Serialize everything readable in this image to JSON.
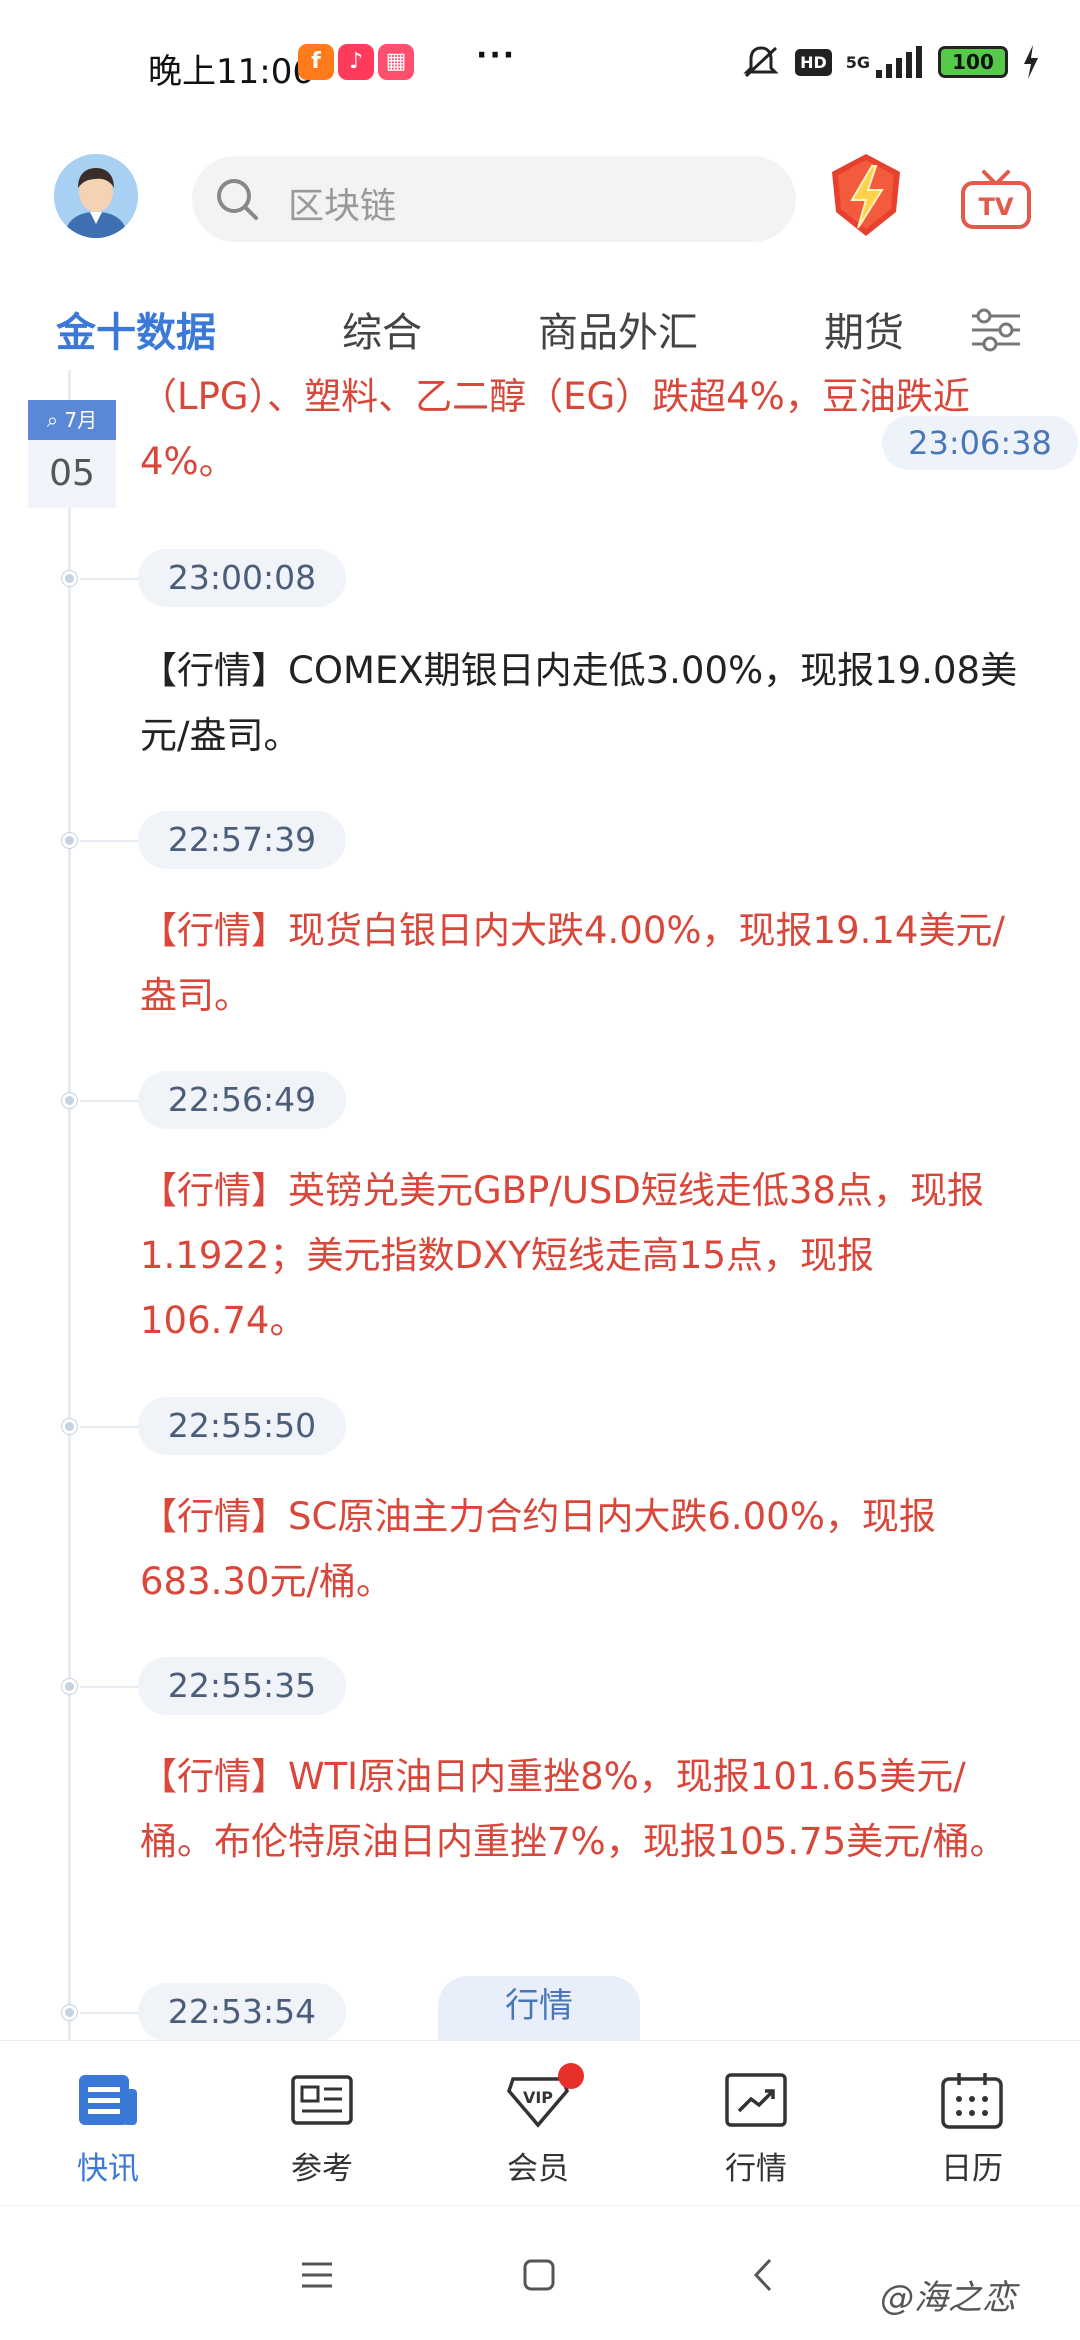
{
  "status_bar": {
    "time": "晚上11:06",
    "more": "···",
    "hd": "HD",
    "network": "5G",
    "battery": "100"
  },
  "header": {
    "search_placeholder": "区块链"
  },
  "tabs": [
    {
      "label": "金十数据",
      "active": true
    },
    {
      "label": "综合",
      "active": false
    },
    {
      "label": "商品外汇",
      "active": false
    },
    {
      "label": "期货",
      "active": false
    }
  ],
  "feed": {
    "date_month": "7月",
    "date_day": "05",
    "current_time": "23:06:38",
    "top_item_text": "（LPG）、塑料、乙二醇（EG）跌超4%，豆油跌近4%。",
    "items": [
      {
        "time": "23:00:08",
        "text": "【行情】COMEX期银日内走低3.00%，现报19.08美元/盎司。",
        "important": false
      },
      {
        "time": "22:57:39",
        "text": "【行情】现货白银日内大跌4.00%，现报19.14美元/盎司。",
        "important": true
      },
      {
        "time": "22:56:49",
        "text": "【行情】英镑兑美元GBP/USD短线走低38点，现报1.1922；美元指数DXY短线走高15点，现报106.74。",
        "important": true
      },
      {
        "time": "22:55:50",
        "text": "【行情】SC原油主力合约日内大跌6.00%，现报683.30元/桶。",
        "important": true
      },
      {
        "time": "22:55:35",
        "text": "【行情】WTI原油日内重挫8%，现报101.65美元/桶。布伦特原油日内重挫7%，现报105.75美元/桶。",
        "important": true
      },
      {
        "time": "22:53:54",
        "text": "",
        "important": false
      }
    ],
    "floating_tag": "行情"
  },
  "bottom_nav": [
    {
      "label": "快讯",
      "icon": "news-icon",
      "active": true
    },
    {
      "label": "参考",
      "icon": "reference-icon",
      "active": false
    },
    {
      "label": "会员",
      "icon": "vip-icon",
      "active": false
    },
    {
      "label": "行情",
      "icon": "market-chart-icon",
      "active": false
    },
    {
      "label": "日历",
      "icon": "calendar-icon",
      "active": false
    }
  ],
  "watermark": "@海之恋",
  "colors": {
    "accent": "#3b79d8",
    "important_text": "#d9473a",
    "normal_text": "#222222"
  }
}
